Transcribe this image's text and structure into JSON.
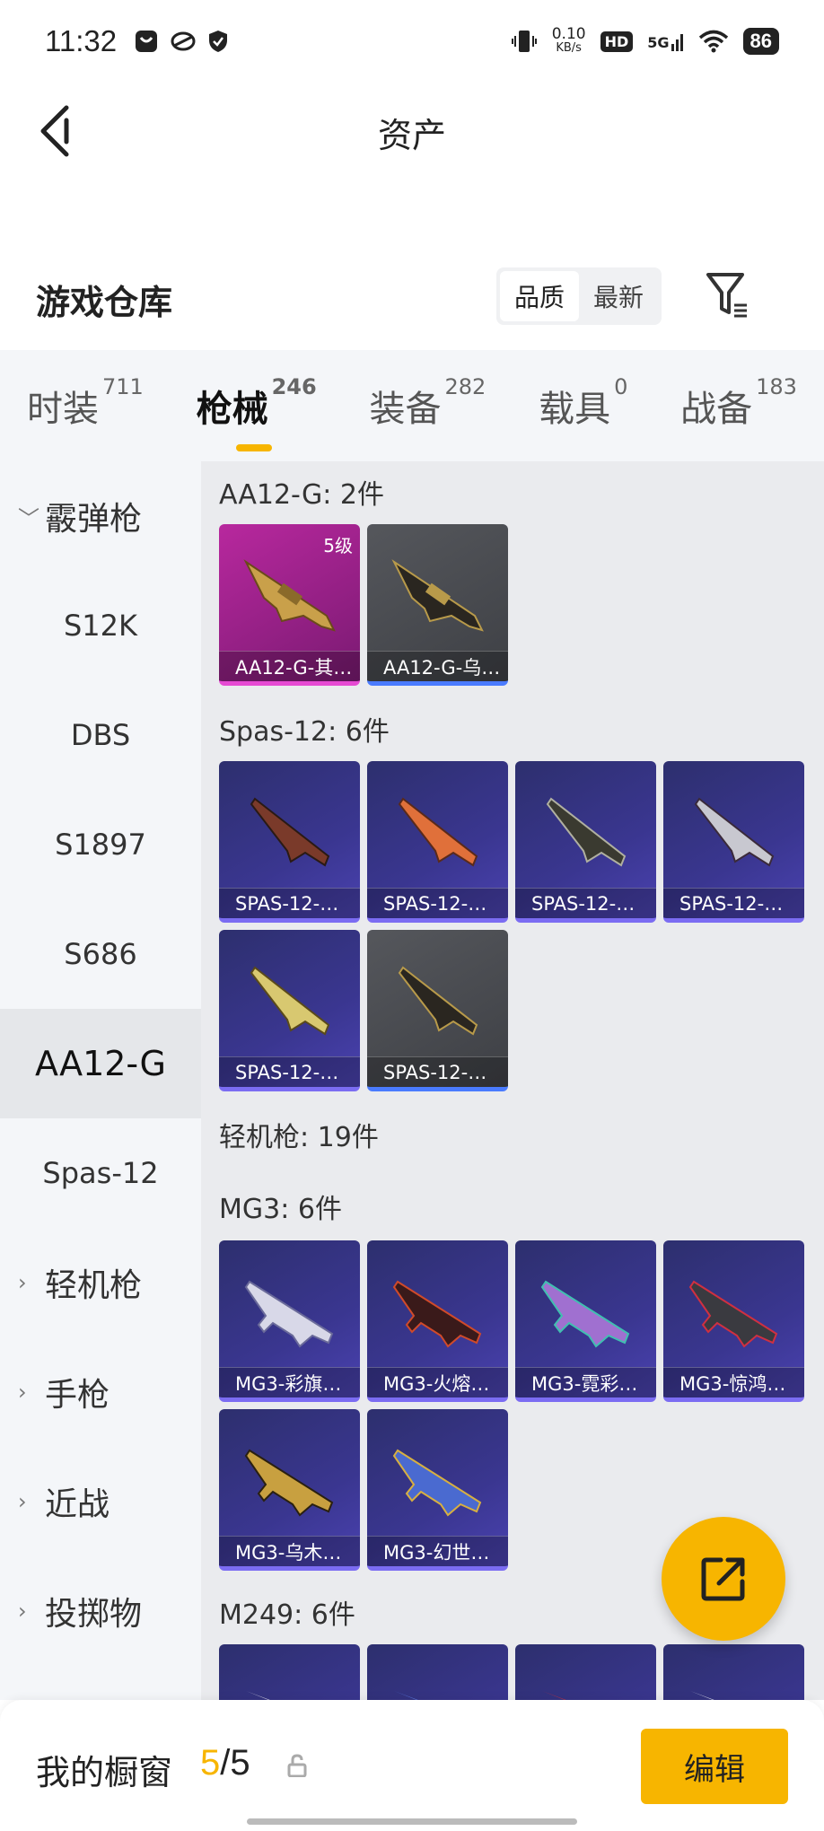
{
  "status_bar": {
    "time": "11:32",
    "net_speed_value": "0.10",
    "net_speed_unit": "KB/s",
    "hd": "HD",
    "signal": "5G",
    "battery": "86"
  },
  "header": {
    "title": "资产"
  },
  "warehouse": {
    "title": "游戏仓库",
    "sort_options": [
      "品质",
      "最新"
    ],
    "selected_sort": "品质"
  },
  "tabs": [
    {
      "label": "时装",
      "count": "711"
    },
    {
      "label": "枪械",
      "count": "246",
      "active": true
    },
    {
      "label": "装备",
      "count": "282"
    },
    {
      "label": "载具",
      "count": "0"
    },
    {
      "label": "战备",
      "count": "183"
    }
  ],
  "sidebar": {
    "items": [
      "霰弹枪",
      "S12K",
      "DBS",
      "S1897",
      "S686",
      "AA12-G",
      "Spas-12",
      "轻机枪",
      "手枪",
      "近战",
      "投掷物"
    ],
    "selected": "AA12-G"
  },
  "sections": [
    {
      "title": "AA12-G: 2件",
      "items": [
        {
          "name": "AA12-G-其…",
          "badge": "5级",
          "rarity": "gold"
        },
        {
          "name": "AA12-G-乌…",
          "rarity": "grey"
        }
      ]
    },
    {
      "title": "Spas-12: 6件",
      "items": [
        {
          "name": "SPAS-12-…"
        },
        {
          "name": "SPAS-12-…"
        },
        {
          "name": "SPAS-12-…"
        },
        {
          "name": "SPAS-12-…"
        },
        {
          "name": "SPAS-12-…"
        },
        {
          "name": "SPAS-12-…"
        }
      ]
    },
    {
      "title": "轻机枪: 19件"
    },
    {
      "title": "MG3: 6件",
      "items": [
        {
          "name": "MG3-彩旗…"
        },
        {
          "name": "MG3-火熔…"
        },
        {
          "name": "MG3-霓彩…"
        },
        {
          "name": "MG3-惊鸿…"
        },
        {
          "name": "MG3-乌木…"
        },
        {
          "name": "MG3-幻世…"
        }
      ]
    },
    {
      "title": "M249: 6件"
    }
  ],
  "showcase": {
    "label": "我的橱窗",
    "current": "5",
    "separator": "/",
    "total": "5",
    "edit_label": "编辑"
  },
  "colors": {
    "accent": "#f7b500",
    "purple_card": "#3a3690",
    "gold_card": "#b8289e",
    "grey_card": "#4a4c51"
  },
  "icons": [
    "back-arrow-icon",
    "filter-icon",
    "share-icon",
    "lock-icon",
    "chevron-down-icon",
    "chevron-right-icon"
  ]
}
